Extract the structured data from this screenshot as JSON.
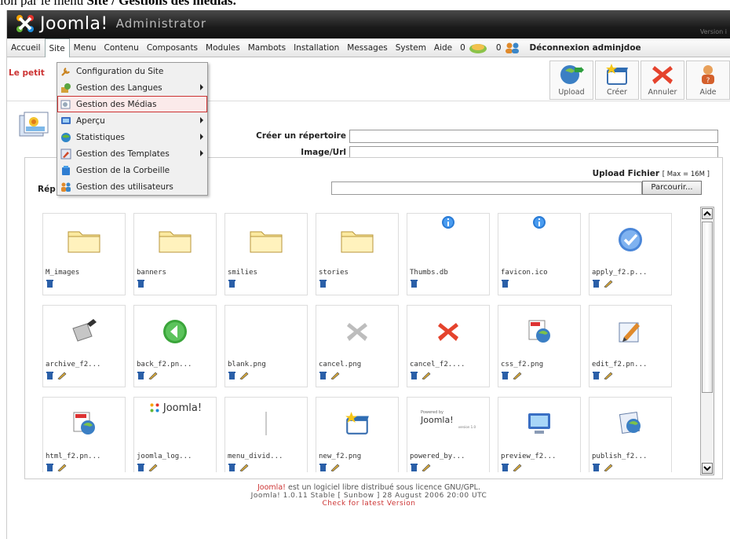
{
  "caption": {
    "prefix": "ion par le menu ",
    "site": "Site",
    "sep": " / ",
    "target": "Gestions des médias",
    "suffix": "."
  },
  "header": {
    "logo_text": "Joomla!",
    "logo_sub": "Administrator",
    "version": "Version i"
  },
  "menubar": {
    "items": [
      "Accueil",
      "Site",
      "Menu",
      "Contenu",
      "Composants",
      "Modules",
      "Mambots",
      "Installation",
      "Messages",
      "System",
      "Aide"
    ],
    "messages_count": "0",
    "users_count": "0",
    "logout": "Déconnexion adminjdoe"
  },
  "site_name": "Le petit",
  "toolbar": [
    {
      "label": "Upload",
      "icon": "upload-icon"
    },
    {
      "label": "Créer",
      "icon": "new-folder-icon"
    },
    {
      "label": "Annuler",
      "icon": "cancel-icon"
    },
    {
      "label": "Aide",
      "icon": "help-icon"
    }
  ],
  "dropdown": {
    "items": [
      {
        "label": "Configuration du Site",
        "icon": "wrench-icon",
        "submenu": false
      },
      {
        "label": "Gestion des Langues",
        "icon": "language-icon",
        "submenu": true
      },
      {
        "label": "Gestion des Médias",
        "icon": "media-icon",
        "submenu": false,
        "highlighted": true
      },
      {
        "label": "Aperçu",
        "icon": "preview-icon",
        "submenu": true
      },
      {
        "label": "Statistiques",
        "icon": "stats-icon",
        "submenu": true
      },
      {
        "label": "Gestion des Templates",
        "icon": "templates-icon",
        "submenu": true
      },
      {
        "label": "Gestion de la Corbeille",
        "icon": "trash-icon",
        "submenu": false
      },
      {
        "label": "Gestion des utilisateurs",
        "icon": "users-icon",
        "submenu": false
      }
    ]
  },
  "form": {
    "create_dir_label": "Créer un répertoire",
    "image_url_label": "Image/Url",
    "create_dir_value": "",
    "image_url_value": ""
  },
  "panel": {
    "title": "Rép",
    "upload_label": "Upload Fichier",
    "upload_max": "[ Max = 16M ]",
    "browse_label": "Parcourir..."
  },
  "files": [
    {
      "name": "M_images",
      "kind": "folder",
      "edit": false
    },
    {
      "name": "banners",
      "kind": "folder",
      "edit": false
    },
    {
      "name": "smilies",
      "kind": "folder",
      "edit": false
    },
    {
      "name": "stories",
      "kind": "folder",
      "edit": false
    },
    {
      "name": "Thumbs.db",
      "kind": "info",
      "edit": false
    },
    {
      "name": "favicon.ico",
      "kind": "info",
      "edit": false
    },
    {
      "name": "apply_f2.p...",
      "kind": "apply",
      "edit": true
    },
    {
      "name": "archive_f2...",
      "kind": "archive",
      "edit": true
    },
    {
      "name": "back_f2.pn...",
      "kind": "back",
      "edit": true
    },
    {
      "name": "blank.png",
      "kind": "blank",
      "edit": true
    },
    {
      "name": "cancel.png",
      "kind": "cancel-grey",
      "edit": true
    },
    {
      "name": "cancel_f2....",
      "kind": "cancel-red",
      "edit": true
    },
    {
      "name": "css_f2.png",
      "kind": "css",
      "edit": true
    },
    {
      "name": "edit_f2.pn...",
      "kind": "edit",
      "edit": true
    },
    {
      "name": "html_f2.pn...",
      "kind": "html",
      "edit": true
    },
    {
      "name": "joomla_log...",
      "kind": "joomla-logo",
      "edit": true
    },
    {
      "name": "menu_divid...",
      "kind": "divider",
      "edit": true
    },
    {
      "name": "new_f2.png",
      "kind": "new",
      "edit": true
    },
    {
      "name": "powered_by...",
      "kind": "powered",
      "edit": true
    },
    {
      "name": "preview_f2...",
      "kind": "preview",
      "edit": true
    },
    {
      "name": "publish_f2...",
      "kind": "publish",
      "edit": true
    }
  ],
  "thumb_texts": {
    "joomla": "Joomla!",
    "powered_by": "Powered by",
    "powered_brand": "Joomla!",
    "powered_version": "version 1.0"
  },
  "footer": {
    "link": "Joomla!",
    "text": " est un logiciel libre distribué sous licence GNU/GPL.",
    "version": "Joomla! 1.0.11 Stable [ Sunbow ] 28 August 2006 20:00 UTC",
    "check": "Check for latest Version"
  }
}
